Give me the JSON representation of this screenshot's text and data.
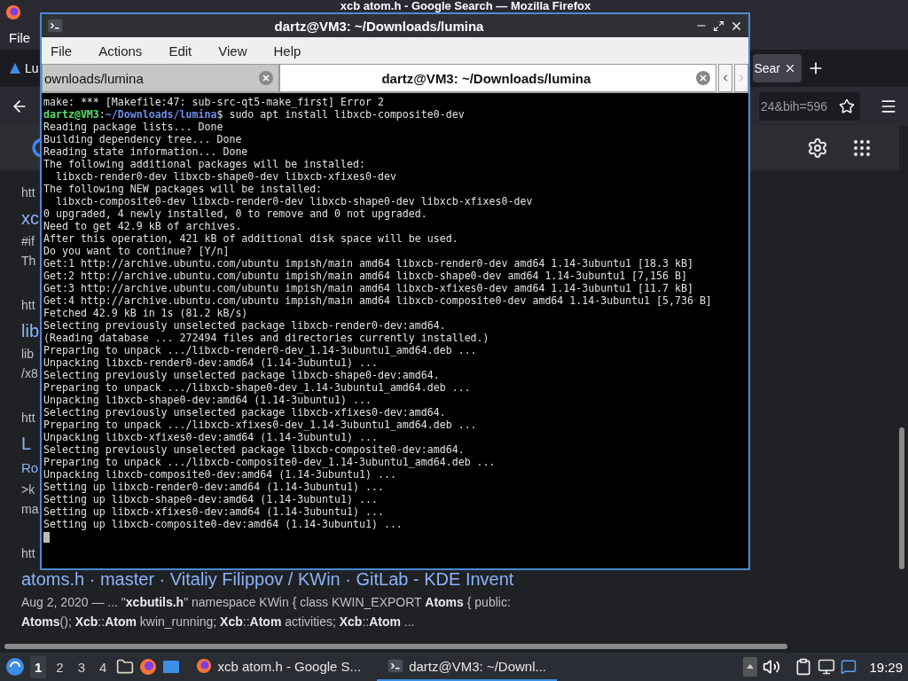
{
  "browser": {
    "title": "xcb atom.h - Google Search — Mozilla Firefox",
    "menu": [
      "File"
    ],
    "tabs": [
      {
        "label": "Lu",
        "selected": false
      },
      {
        "label": "Sear",
        "selected": true
      }
    ],
    "address": {
      "value": "24&bih=596"
    },
    "results": [
      {
        "url": "htt",
        "title": "xc",
        "snippet": [
          "#if",
          "Th"
        ]
      },
      {
        "url": "htt",
        "title": "lib",
        "snippet": [
          "lib",
          "/x8"
        ]
      },
      {
        "url": "htt",
        "title": "L",
        "sublink": "Ro",
        "snippet": [
          ">k",
          "ma"
        ]
      },
      {
        "url": "htt",
        "title": "atoms.h · master · Vitaliy Filippov / KWin · GitLab - KDE Invent",
        "snippet": [
          "Aug 2, 2020 — ... \"**xcbutils.h**\" namespace KWin { class KWIN_EXPORT **Atoms** { public:",
          "**Atoms**(); **Xcb**::**Atom** kwin_running; **Xcb**::**Atom** activities; **Xcb**::**Atom** ..."
        ]
      }
    ]
  },
  "terminal": {
    "title": "dartz@VM3: ~/Downloads/lumina",
    "menu": [
      "File",
      "Actions",
      "Edit",
      "View",
      "Help"
    ],
    "tabs": [
      {
        "label": "ownloads/lumina",
        "selected": false
      },
      {
        "label": "dartz@VM3: ~/Downloads/lumina",
        "selected": true
      }
    ],
    "lines": [
      {
        "kind": "output",
        "text": "make: *** [Makefile:47: sub-src-qt5-make_first] Error 2"
      },
      {
        "kind": "prompt",
        "user": "dartz@VM3",
        "separator": ":",
        "path": "~/Downloads/lumina",
        "command": "$ sudo apt install libxcb-composite0-dev"
      },
      {
        "kind": "output",
        "text": "Reading package lists... Done"
      },
      {
        "kind": "output",
        "text": "Building dependency tree... Done"
      },
      {
        "kind": "output",
        "text": "Reading state information... Done"
      },
      {
        "kind": "output",
        "text": "The following additional packages will be installed:"
      },
      {
        "kind": "output",
        "text": "  libxcb-render0-dev libxcb-shape0-dev libxcb-xfixes0-dev"
      },
      {
        "kind": "output",
        "text": "The following NEW packages will be installed:"
      },
      {
        "kind": "output",
        "text": "  libxcb-composite0-dev libxcb-render0-dev libxcb-shape0-dev libxcb-xfixes0-dev"
      },
      {
        "kind": "output",
        "text": "0 upgraded, 4 newly installed, 0 to remove and 0 not upgraded."
      },
      {
        "kind": "output",
        "text": "Need to get 42.9 kB of archives."
      },
      {
        "kind": "output",
        "text": "After this operation, 421 kB of additional disk space will be used."
      },
      {
        "kind": "output",
        "text": "Do you want to continue? [Y/n]"
      },
      {
        "kind": "output",
        "text": "Get:1 http://archive.ubuntu.com/ubuntu impish/main amd64 libxcb-render0-dev amd64 1.14-3ubuntu1 [18.3 kB]"
      },
      {
        "kind": "output",
        "text": "Get:2 http://archive.ubuntu.com/ubuntu impish/main amd64 libxcb-shape0-dev amd64 1.14-3ubuntu1 [7,156 B]"
      },
      {
        "kind": "output",
        "text": "Get:3 http://archive.ubuntu.com/ubuntu impish/main amd64 libxcb-xfixes0-dev amd64 1.14-3ubuntu1 [11.7 kB]"
      },
      {
        "kind": "output",
        "text": "Get:4 http://archive.ubuntu.com/ubuntu impish/main amd64 libxcb-composite0-dev amd64 1.14-3ubuntu1 [5,736 B]"
      },
      {
        "kind": "output",
        "text": "Fetched 42.9 kB in 1s (81.2 kB/s)"
      },
      {
        "kind": "output",
        "text": "Selecting previously unselected package libxcb-render0-dev:amd64."
      },
      {
        "kind": "output",
        "text": "(Reading database ... 272494 files and directories currently installed.)"
      },
      {
        "kind": "output",
        "text": "Preparing to unpack .../libxcb-render0-dev_1.14-3ubuntu1_amd64.deb ..."
      },
      {
        "kind": "output",
        "text": "Unpacking libxcb-render0-dev:amd64 (1.14-3ubuntu1) ..."
      },
      {
        "kind": "output",
        "text": "Selecting previously unselected package libxcb-shape0-dev:amd64."
      },
      {
        "kind": "output",
        "text": "Preparing to unpack .../libxcb-shape0-dev_1.14-3ubuntu1_amd64.deb ..."
      },
      {
        "kind": "output",
        "text": "Unpacking libxcb-shape0-dev:amd64 (1.14-3ubuntu1) ..."
      },
      {
        "kind": "output",
        "text": "Selecting previously unselected package libxcb-xfixes0-dev:amd64."
      },
      {
        "kind": "output",
        "text": "Preparing to unpack .../libxcb-xfixes0-dev_1.14-3ubuntu1_amd64.deb ..."
      },
      {
        "kind": "output",
        "text": "Unpacking libxcb-xfixes0-dev:amd64 (1.14-3ubuntu1) ..."
      },
      {
        "kind": "output",
        "text": "Selecting previously unselected package libxcb-composite0-dev:amd64."
      },
      {
        "kind": "output",
        "text": "Preparing to unpack .../libxcb-composite0-dev_1.14-3ubuntu1_amd64.deb ..."
      },
      {
        "kind": "output",
        "text": "Unpacking libxcb-composite0-dev:amd64 (1.14-3ubuntu1) ..."
      },
      {
        "kind": "output",
        "text": "Setting up libxcb-render0-dev:amd64 (1.14-3ubuntu1) ..."
      },
      {
        "kind": "output",
        "text": "Setting up libxcb-shape0-dev:amd64 (1.14-3ubuntu1) ..."
      },
      {
        "kind": "output",
        "text": "Setting up libxcb-xfixes0-dev:amd64 (1.14-3ubuntu1) ..."
      },
      {
        "kind": "output",
        "text": "Setting up libxcb-composite0-dev:amd64 (1.14-3ubuntu1) ..."
      }
    ]
  },
  "taskbar": {
    "workspaces": [
      {
        "label": "1",
        "selected": true
      },
      {
        "label": "2",
        "selected": false
      },
      {
        "label": "3",
        "selected": false
      },
      {
        "label": "4",
        "selected": false
      }
    ],
    "tasks": [
      {
        "kind": "browser",
        "label": "xcb atom.h - Google S...",
        "selected": false
      },
      {
        "kind": "terminal",
        "label": "dartz@VM3: ~/Downl...",
        "selected": true
      }
    ],
    "clock": "19:29"
  }
}
